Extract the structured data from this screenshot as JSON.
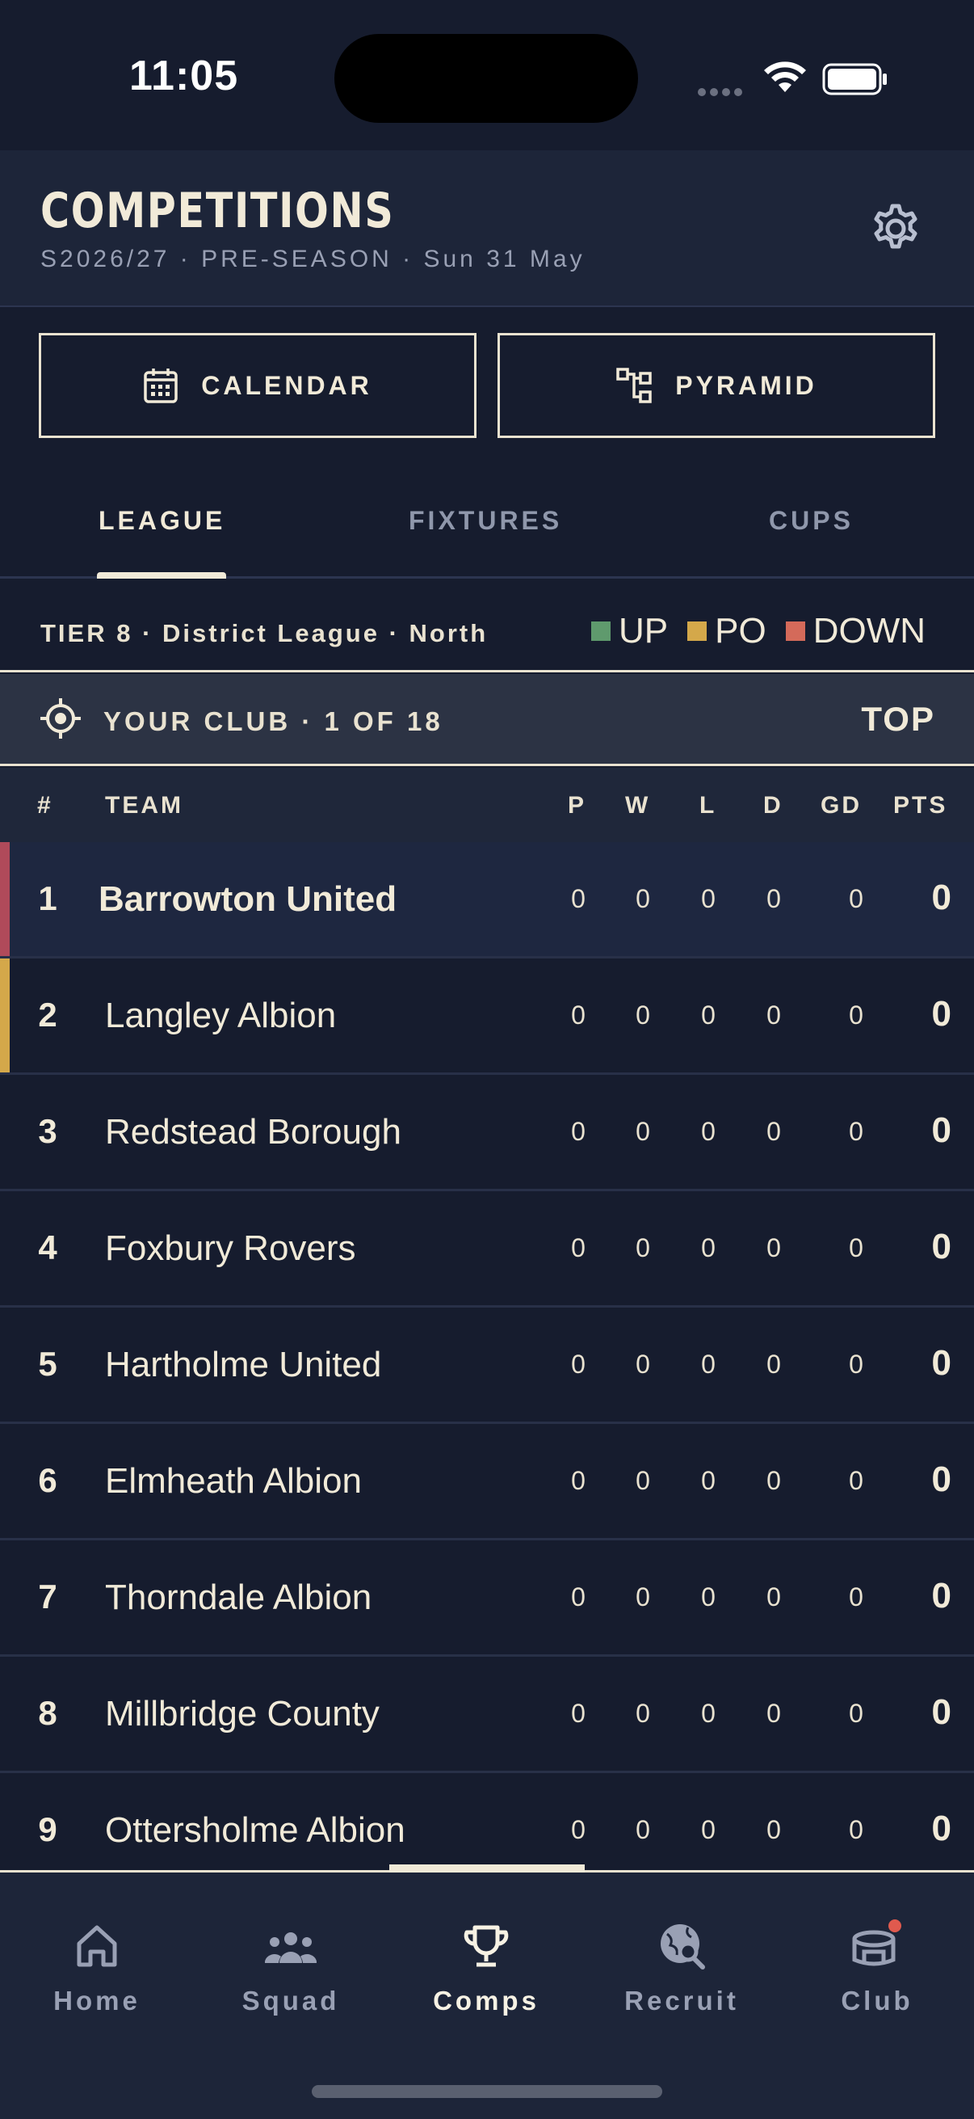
{
  "status": {
    "time": "11:05"
  },
  "header": {
    "title": "COMPETITIONS",
    "subtitle": "S2026/27 · PRE-SEASON · Sun 31 May"
  },
  "buttons": {
    "calendar": "CALENDAR",
    "pyramid": "PYRAMID"
  },
  "tabs": [
    {
      "label": "LEAGUE",
      "active": true
    },
    {
      "label": "FIXTURES",
      "active": false
    },
    {
      "label": "CUPS",
      "active": false
    }
  ],
  "tier": {
    "text": "TIER 8 · District League · North"
  },
  "legend": [
    {
      "label": "UP",
      "color": "#5f9a6d"
    },
    {
      "label": "PO",
      "color": "#d4a84a"
    },
    {
      "label": "DOWN",
      "color": "#d46a5a"
    }
  ],
  "your_club": {
    "text": "YOUR CLUB · 1 OF 18",
    "top_label": "TOP"
  },
  "table": {
    "headers": {
      "pos": "#",
      "team": "TEAM",
      "p": "P",
      "w": "W",
      "l": "L",
      "d": "D",
      "gd": "GD",
      "pts": "PTS"
    },
    "rows": [
      {
        "pos": "1",
        "team": "Barrowton United",
        "p": "0",
        "w": "0",
        "l": "0",
        "d": "0",
        "gd": "0",
        "pts": "0"
      },
      {
        "pos": "2",
        "team": "Langley Albion",
        "p": "0",
        "w": "0",
        "l": "0",
        "d": "0",
        "gd": "0",
        "pts": "0"
      },
      {
        "pos": "3",
        "team": "Redstead Borough",
        "p": "0",
        "w": "0",
        "l": "0",
        "d": "0",
        "gd": "0",
        "pts": "0"
      },
      {
        "pos": "4",
        "team": "Foxbury Rovers",
        "p": "0",
        "w": "0",
        "l": "0",
        "d": "0",
        "gd": "0",
        "pts": "0"
      },
      {
        "pos": "5",
        "team": "Hartholme United",
        "p": "0",
        "w": "0",
        "l": "0",
        "d": "0",
        "gd": "0",
        "pts": "0"
      },
      {
        "pos": "6",
        "team": "Elmheath Albion",
        "p": "0",
        "w": "0",
        "l": "0",
        "d": "0",
        "gd": "0",
        "pts": "0"
      },
      {
        "pos": "7",
        "team": "Thorndale Albion",
        "p": "0",
        "w": "0",
        "l": "0",
        "d": "0",
        "gd": "0",
        "pts": "0"
      },
      {
        "pos": "8",
        "team": "Millbridge County",
        "p": "0",
        "w": "0",
        "l": "0",
        "d": "0",
        "gd": "0",
        "pts": "0"
      },
      {
        "pos": "9",
        "team": "Ottersholme Albion",
        "p": "0",
        "w": "0",
        "l": "0",
        "d": "0",
        "gd": "0",
        "pts": "0"
      }
    ],
    "my_club_color": "#b04a5a",
    "playoff_color": "#d4a84a"
  },
  "nav": [
    {
      "label": "Home",
      "icon": "home-icon",
      "active": false
    },
    {
      "label": "Squad",
      "icon": "squad-icon",
      "active": false
    },
    {
      "label": "Comps",
      "icon": "trophy-icon",
      "active": true
    },
    {
      "label": "Recruit",
      "icon": "recruit-icon",
      "active": false
    },
    {
      "label": "Club",
      "icon": "club-icon",
      "active": false
    }
  ],
  "colors": {
    "background": "#161c2e",
    "header": "#1d2539",
    "accent": "#f1ead8",
    "notification": "#e05a4e"
  }
}
